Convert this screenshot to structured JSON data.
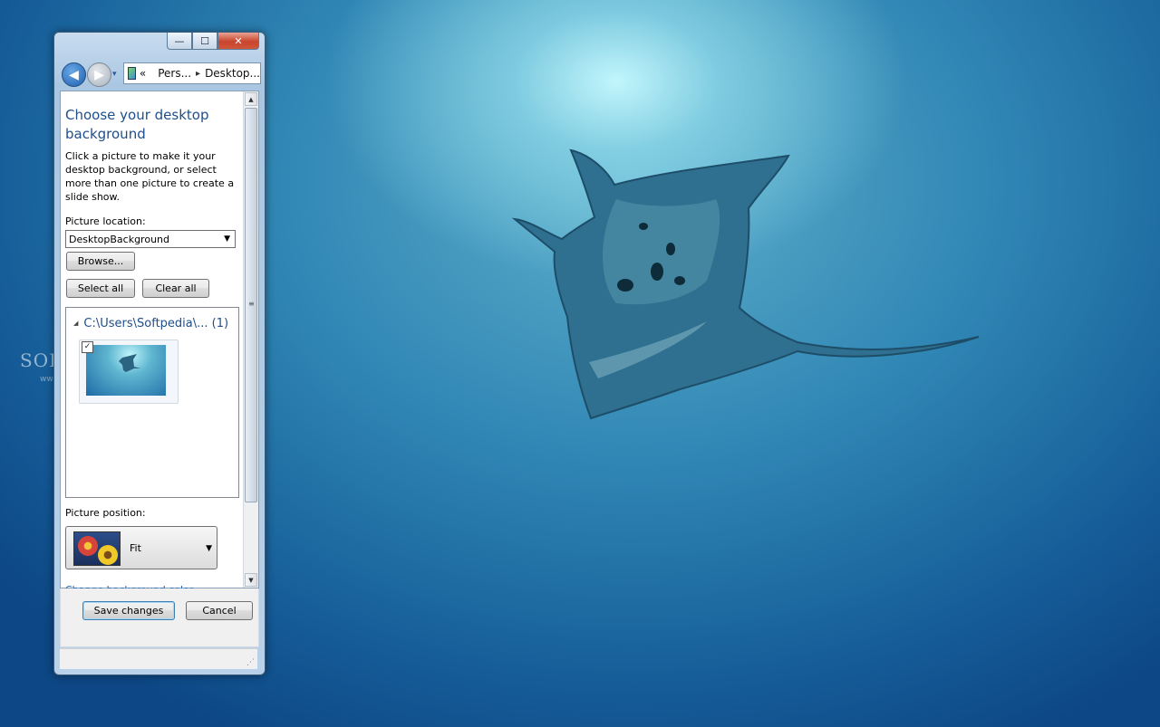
{
  "window": {
    "caption": {
      "minimize": "—",
      "maximize": "☐",
      "close": "✕"
    },
    "nav": {
      "back": "◀",
      "forward": "▶",
      "history": "▾"
    },
    "address": {
      "overflow": "«",
      "segments": [
        "Pers...",
        "Desktop..."
      ],
      "sep": "▸"
    }
  },
  "content": {
    "title": "Choose your desktop background",
    "description": "Click a picture to make it your desktop background, or select more than one picture to create a slide show.",
    "picture_location_label": "Picture location:",
    "picture_location_value": "DesktopBackground",
    "browse_label": "Browse...",
    "select_all_label": "Select all",
    "clear_all_label": "Clear all",
    "gallery": {
      "group_title": "C:\\Users\\Softpedia\\... (1)",
      "items": [
        {
          "checked": true,
          "check_mark": "✓"
        }
      ]
    },
    "picture_position_label": "Picture position:",
    "picture_position_value": "Fit",
    "change_bg_color_link": "Change background color"
  },
  "footer": {
    "save_label": "Save changes",
    "cancel_label": "Cancel"
  },
  "desktop": {
    "watermark": "SOFTPEDIA",
    "watermark_url": "www.softpedia.com"
  },
  "colors": {
    "title_blue": "#1e4e8c",
    "link_blue": "#1c63b7",
    "close_red": "#c9452d"
  }
}
